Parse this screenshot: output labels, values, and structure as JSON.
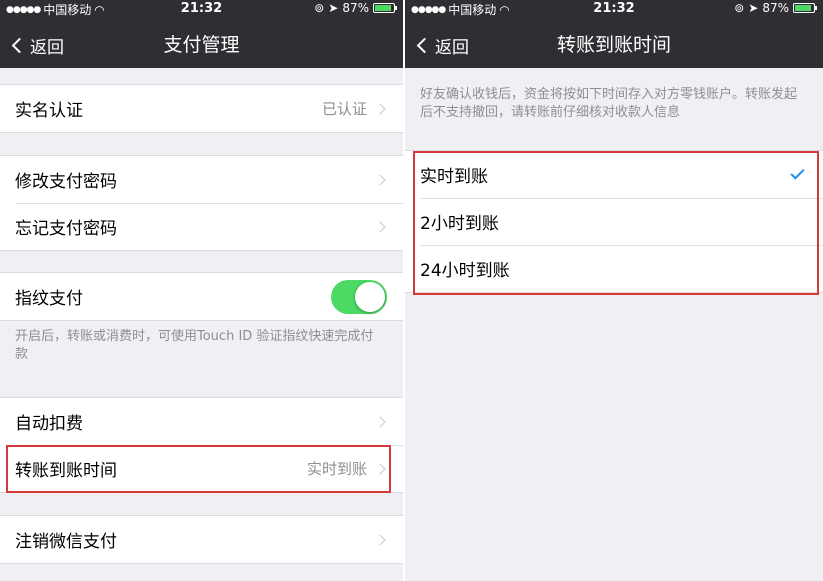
{
  "colors": {
    "nav_bg": "#2f2e33",
    "toggle_on": "#4cd964",
    "highlight": "#d43a3a",
    "check": "#1f8fef"
  },
  "status": {
    "carrier": "中国移动",
    "time": "21:32",
    "battery": "87%",
    "battery_level": 0.87
  },
  "left": {
    "back_label": "返回",
    "title": "支付管理",
    "groups": {
      "verify": {
        "label": "实名认证",
        "value": "已认证"
      },
      "password": [
        {
          "label": "修改支付密码"
        },
        {
          "label": "忘记支付密码"
        }
      ],
      "fingerprint": {
        "label": "指纹支付",
        "enabled": true,
        "note": "开启后，转账或消费时，可使用Touch ID 验证指纹快速完成付款"
      },
      "auto": {
        "label": "自动扣费"
      },
      "transfer_time": {
        "label": "转账到账时间",
        "value": "实时到账"
      },
      "cancel": {
        "label": "注销微信支付"
      }
    }
  },
  "right": {
    "back_label": "返回",
    "title": "转账到账时间",
    "description": "好友确认收钱后，资金将按如下时间存入对方零钱账户。转账发起后不支持撤回，请转账前仔细核对收款人信息",
    "options": [
      {
        "label": "实时到账",
        "selected": true
      },
      {
        "label": "2小时到账",
        "selected": false
      },
      {
        "label": "24小时到账",
        "selected": false
      }
    ]
  }
}
